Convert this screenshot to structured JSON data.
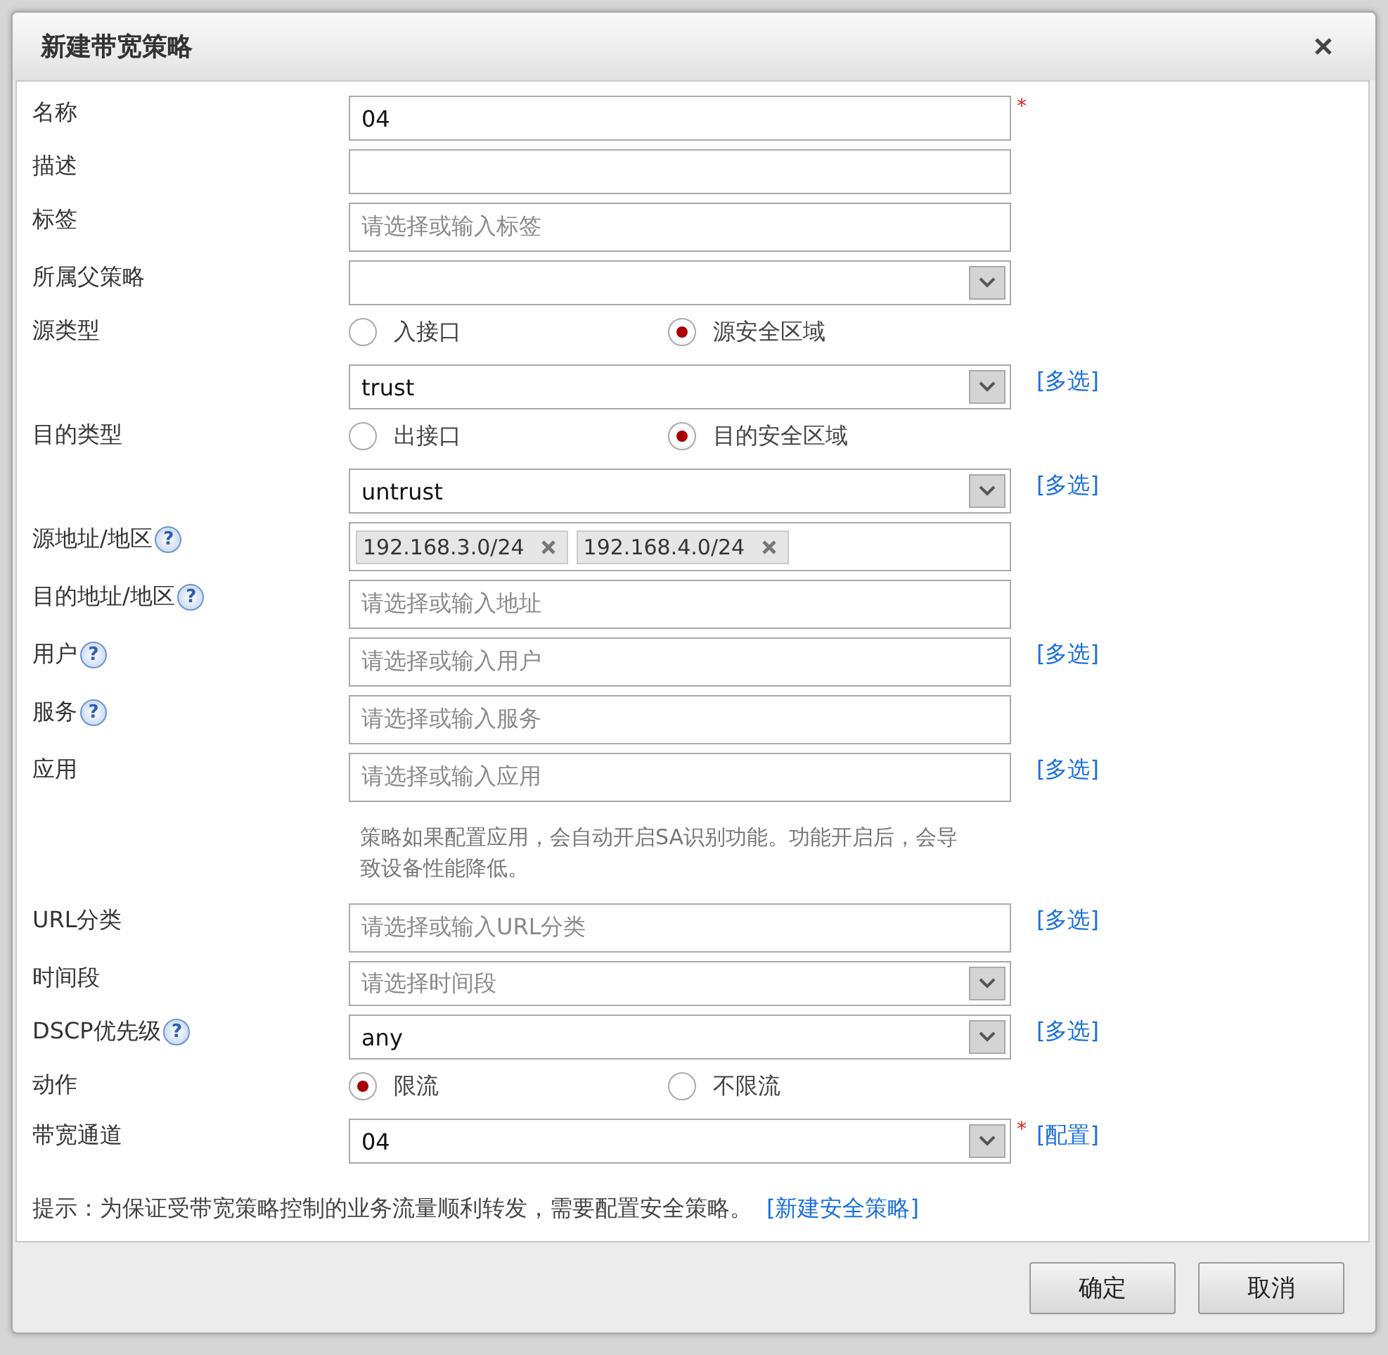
{
  "dialog": {
    "title": "新建带宽策略"
  },
  "rows": [
    {
      "kind": "text",
      "label": "名称",
      "value": "04",
      "required": "*"
    },
    {
      "kind": "text",
      "label": "描述",
      "value": ""
    },
    {
      "kind": "tagbox",
      "label": "标签",
      "placeholder": "请选择或输入标签"
    },
    {
      "kind": "select",
      "label": "所属父策略",
      "value": ""
    },
    {
      "kind": "radio",
      "label": "源类型",
      "options": [
        {
          "label": "入接口",
          "selected": false
        },
        {
          "label": "源安全区域",
          "selected": true
        }
      ]
    },
    {
      "kind": "select",
      "value": "trust",
      "link": "[多选]"
    },
    {
      "kind": "radio",
      "label": "目的类型",
      "options": [
        {
          "label": "出接口",
          "selected": false
        },
        {
          "label": "目的安全区域",
          "selected": true
        }
      ]
    },
    {
      "kind": "select",
      "value": "untrust",
      "link": "[多选]"
    },
    {
      "kind": "tagbox",
      "label": "源地址/地区",
      "help": "?",
      "tags": [
        "192.168.3.0/24",
        "192.168.4.0/24"
      ]
    },
    {
      "kind": "tagbox",
      "label": "目的地址/地区",
      "help": "?",
      "placeholder": "请选择或输入地址"
    },
    {
      "kind": "tagbox",
      "label": "用户",
      "help": "?",
      "placeholder": "请选择或输入用户",
      "link": "[多选]"
    },
    {
      "kind": "tagbox",
      "label": "服务",
      "help": "?",
      "placeholder": "请选择或输入服务"
    },
    {
      "kind": "tagbox",
      "label": "应用",
      "placeholder": "请选择或输入应用",
      "link": "[多选]"
    },
    {
      "kind": "note",
      "text": "策略如果配置应用，会自动开启SA识别功能。功能开启后，会导致设备性能降低。"
    },
    {
      "kind": "tagbox",
      "label": "URL分类",
      "placeholder": "请选择或输入URL分类",
      "link": "[多选]"
    },
    {
      "kind": "select",
      "label": "时间段",
      "placeholder": "请选择时间段"
    },
    {
      "kind": "select",
      "label": "DSCP优先级",
      "help": "?",
      "value": "any",
      "link": "[多选]"
    },
    {
      "kind": "radio",
      "label": "动作",
      "options": [
        {
          "label": "限流",
          "selected": true
        },
        {
          "label": "不限流",
          "selected": false
        }
      ]
    },
    {
      "kind": "select",
      "label": "带宽通道",
      "value": "04",
      "required": "*",
      "link": "[配置]"
    }
  ],
  "hint": {
    "text": "提示：为保证受带宽策略控制的业务流量顺利转发，需要配置安全策略。",
    "link": "[新建安全策略]"
  },
  "buttons": [
    "确定",
    "取消"
  ]
}
